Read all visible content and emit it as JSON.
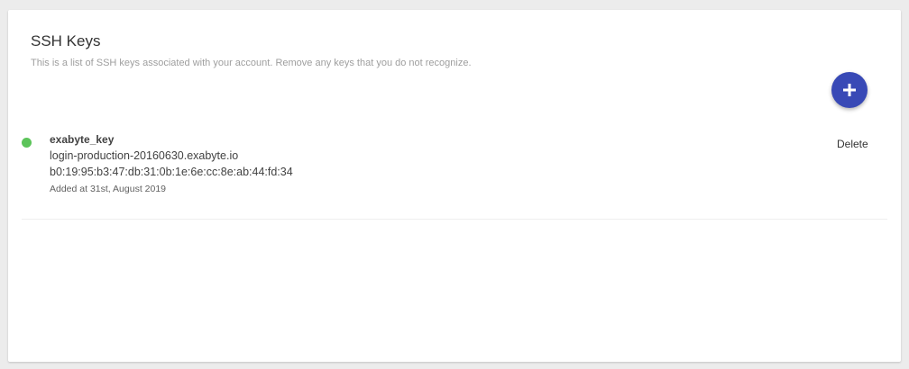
{
  "card": {
    "title": "SSH Keys",
    "subtitle": "This is a list of SSH keys associated with your account. Remove any keys that you do not recognize.",
    "add_button_icon": "plus-icon"
  },
  "keys": [
    {
      "name": "exabyte_key",
      "host": "login-production-20160630.exabyte.io",
      "fingerprint": "b0:19:95:b3:47:db:31:0b:1e:6e:cc:8e:ab:44:fd:34",
      "added": "Added at 31st, August 2019",
      "status_color": "#5cc45a",
      "delete_label": "Delete"
    }
  ],
  "colors": {
    "accent": "#3849b6",
    "active_status": "#5cc45a"
  }
}
